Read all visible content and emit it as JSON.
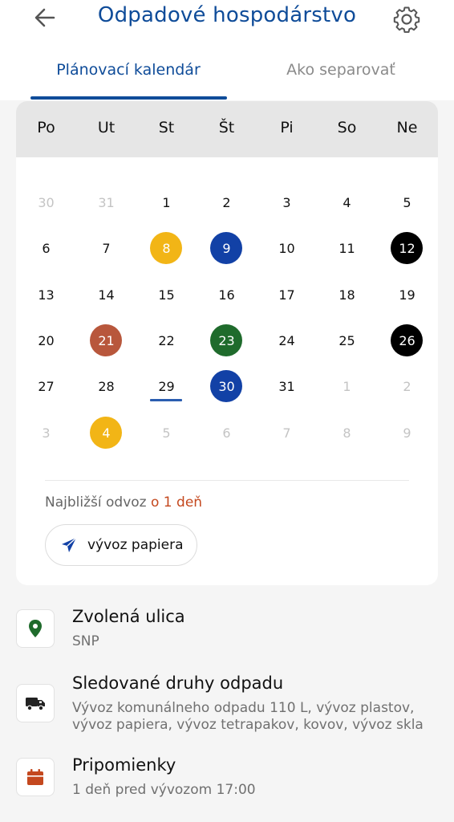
{
  "header": {
    "title": "Odpadové hospodárstvo",
    "back_icon": "arrow-left-icon",
    "settings_icon": "gear-icon"
  },
  "tabs": [
    {
      "label": "Plánovací kalendár",
      "active": true
    },
    {
      "label": "Ako separovať",
      "active": false
    }
  ],
  "calendar": {
    "weekdays": [
      "Po",
      "Ut",
      "St",
      "Št",
      "Pi",
      "So",
      "Ne"
    ],
    "weeks": [
      [
        {
          "d": "30",
          "m": true
        },
        {
          "d": "31",
          "m": true
        },
        {
          "d": "1"
        },
        {
          "d": "2"
        },
        {
          "d": "3"
        },
        {
          "d": "4"
        },
        {
          "d": "5"
        }
      ],
      [
        {
          "d": "6"
        },
        {
          "d": "7"
        },
        {
          "d": "8",
          "color": "#f2b516"
        },
        {
          "d": "9",
          "color": "#1241a6"
        },
        {
          "d": "10"
        },
        {
          "d": "11"
        },
        {
          "d": "12",
          "color": "#000000"
        }
      ],
      [
        {
          "d": "13"
        },
        {
          "d": "14"
        },
        {
          "d": "15"
        },
        {
          "d": "16"
        },
        {
          "d": "17"
        },
        {
          "d": "18"
        },
        {
          "d": "19"
        }
      ],
      [
        {
          "d": "20"
        },
        {
          "d": "21",
          "color": "#b8573c"
        },
        {
          "d": "22"
        },
        {
          "d": "23",
          "color": "#1f6b2c"
        },
        {
          "d": "24"
        },
        {
          "d": "25"
        },
        {
          "d": "26",
          "color": "#000000"
        }
      ],
      [
        {
          "d": "27"
        },
        {
          "d": "28"
        },
        {
          "d": "29",
          "today": true
        },
        {
          "d": "30",
          "color": "#1241a6"
        },
        {
          "d": "31"
        },
        {
          "d": "1",
          "m": true
        },
        {
          "d": "2",
          "m": true
        }
      ],
      [
        {
          "d": "3",
          "m": true
        },
        {
          "d": "4",
          "color": "#f2b516"
        },
        {
          "d": "5",
          "m": true
        },
        {
          "d": "6",
          "m": true
        },
        {
          "d": "7",
          "m": true
        },
        {
          "d": "8",
          "m": true
        },
        {
          "d": "9",
          "m": true
        }
      ]
    ],
    "next_pickup_prefix": "Najbližší odvoz",
    "next_pickup_value": "o 1 deň",
    "next_pickup_chip": "vývoz papiera",
    "chip_icon": "paper-plane-icon"
  },
  "info": {
    "street_title": "Zvolená ulica",
    "street_value": "SNP",
    "street_icon": "location-pin-icon",
    "waste_title": "Sledované druhy odpadu",
    "waste_value": "Vývoz komunálneho odpadu 110 L, vývoz plastov, vývoz papiera, vývoz tetrapakov, kovov, vývoz skla",
    "waste_icon": "truck-icon",
    "reminder_title": "Pripomienky",
    "reminder_value": "1 deň pred vývozom 17:00",
    "reminder_icon": "calendar-icon"
  },
  "colors": {
    "primary": "#0f4c99",
    "accent": "#c4481e",
    "pin_green": "#1f6b2c",
    "plane_blue": "#1241a6"
  }
}
